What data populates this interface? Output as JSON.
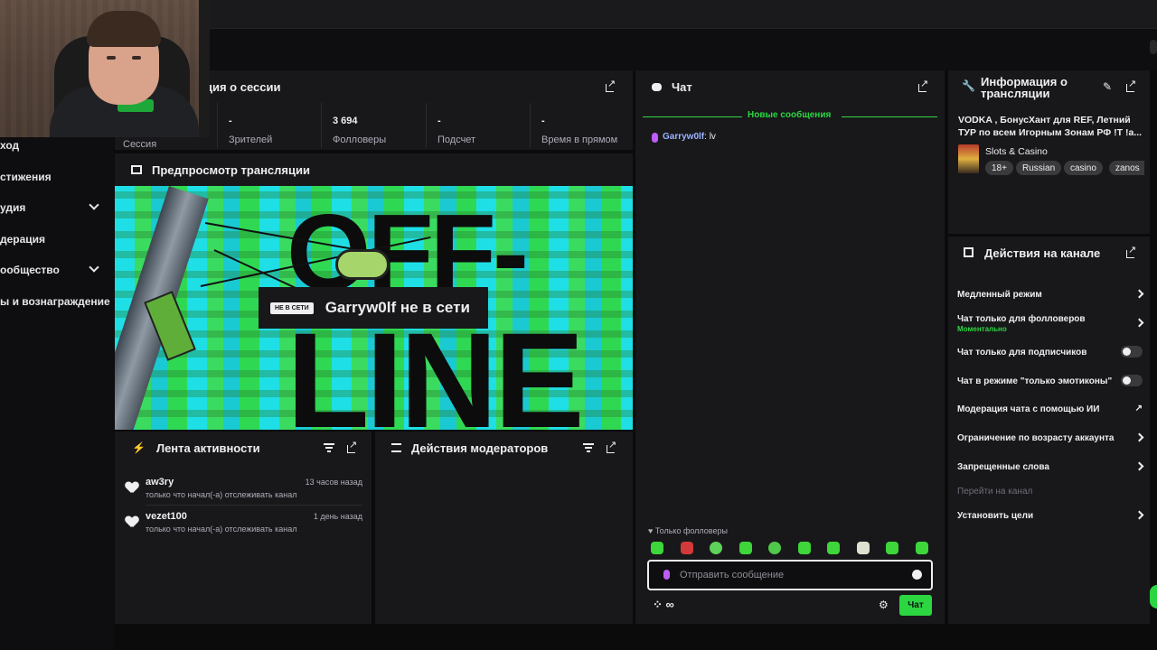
{
  "left_nav": {
    "items": [
      {
        "label": "ход",
        "has_chevron": false
      },
      {
        "label": "стижения",
        "has_chevron": false
      },
      {
        "label": "удия",
        "has_chevron": true
      },
      {
        "label": "дерация",
        "has_chevron": false
      },
      {
        "label": "ообщество",
        "has_chevron": true
      },
      {
        "label": "ы и вознаграждение",
        "has_chevron": false
      }
    ]
  },
  "session": {
    "title": "ция о сессии",
    "stats": [
      {
        "value": "",
        "label": "Сессия"
      },
      {
        "value": "-",
        "label": "Зрителей"
      },
      {
        "value": "3 694",
        "label": "Фолловеры"
      },
      {
        "value": "-",
        "label": "Подсчет"
      },
      {
        "value": "-",
        "label": "Время в прямом"
      }
    ]
  },
  "preview": {
    "title": "Предпросмотр трансляции",
    "offline_tag": "НЕ В СЕТИ",
    "offline_text": "Garryw0lf не в сети",
    "bg_text_1": "OFF-",
    "bg_text_2": "LINE"
  },
  "activity": {
    "title": "Лента активности",
    "items": [
      {
        "user": "aw3ry",
        "time": "13 часов назад",
        "desc": "только что начал(-а) отслеживать канал"
      },
      {
        "user": "vezet100",
        "time": "1 день назад",
        "desc": "только что начал(-а) отслеживать канал"
      }
    ]
  },
  "mod_actions": {
    "title": "Действия модераторов"
  },
  "chat": {
    "title": "Чат",
    "new_messages": "Новые сообщения",
    "messages": [
      {
        "user": "Garryw0lf",
        "text": ": lv"
      }
    ],
    "followers_only": "Только фолловеры",
    "input_placeholder": "Отправить сообщение",
    "send_button": "Чат",
    "points": "∞",
    "emote_colors": [
      "#3ed63a",
      "#d23a3a",
      "#5fd25a",
      "#3ed63a",
      "#4fc94a",
      "#3ed63a",
      "#3ed63a",
      "#e0e0d0",
      "#3ed63a",
      "#3ed63a"
    ]
  },
  "stream_info": {
    "title_line1": "Информация о",
    "title_line2": "трансляции",
    "stream_title": "VODKA , БонусХант для REF, Летний ТУР по всем Игорным Зонам РФ !Т !а...",
    "category": "Slots & Casino",
    "tags": [
      "18+",
      "Russian",
      "casino",
      "zanos"
    ]
  },
  "channel_actions": {
    "title": "Действия на канале",
    "items": [
      {
        "label": "Медленный режим",
        "control": "chevron"
      },
      {
        "label": "Чат только для фолловеров",
        "sub": "Моментально",
        "control": "chevron"
      },
      {
        "label": "Чат только для подписчиков",
        "control": "toggle"
      },
      {
        "label": "Чат в режиме \"только эмотиконы\"",
        "control": "toggle"
      },
      {
        "label": "Модерация чата с помощью ИИ",
        "control": "external"
      },
      {
        "label": "Ограничение по возрасту аккаунта",
        "control": "chevron"
      },
      {
        "label": "Запрещенные слова",
        "control": "chevron"
      },
      {
        "label": "Перейти на канал",
        "control": "none",
        "disabled": true
      },
      {
        "label": "Установить цели",
        "control": "chevron"
      }
    ]
  },
  "colors": {
    "accent": "#2bd641",
    "panel": "#18181b",
    "bg": "#0e0e10"
  }
}
